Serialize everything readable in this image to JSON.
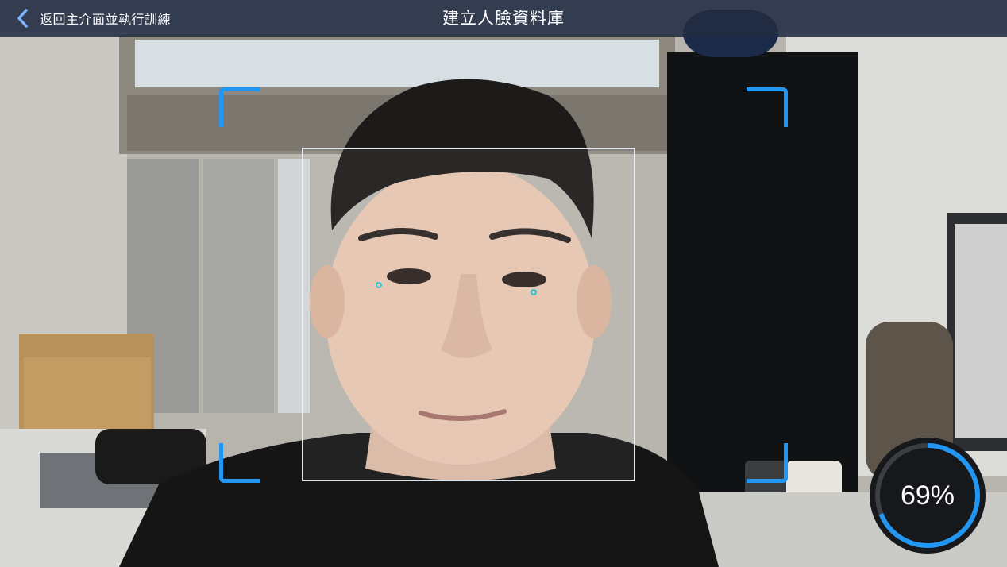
{
  "header": {
    "back_label": "返回主介面並執行訓練",
    "title": "建立人臉資料庫"
  },
  "icons": {
    "back": "chevron-left-icon"
  },
  "colors": {
    "top_bar": "#222c42",
    "accent": "#2196f3",
    "face_box": "#ebf0f5",
    "eye_marker": "#29c7d6",
    "progress_track": "#3a3d42"
  },
  "capture": {
    "progress_percent": 69,
    "progress_label": "69%"
  }
}
